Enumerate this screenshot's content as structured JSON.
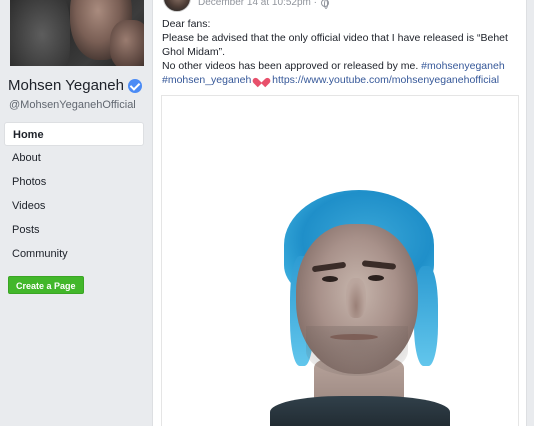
{
  "sidebar": {
    "page_name": "Mohsen Yeganeh",
    "handle": "@MohsenYeganehOfficial",
    "nav": [
      {
        "label": "Home"
      },
      {
        "label": "About"
      },
      {
        "label": "Photos"
      },
      {
        "label": "Videos"
      },
      {
        "label": "Posts"
      },
      {
        "label": "Community"
      }
    ],
    "create_page_label": "Create a Page"
  },
  "post": {
    "timestamp": "December 14 at 10:52pm · ",
    "lines": {
      "greeting": "Dear fans:",
      "line1": "Please be advised that the only official video that I have released is “Behet",
      "line2": "Ghol Midam”.",
      "line3_text": "No other videos has been approved or released by me. ",
      "hashtag1": "#mohsenyeganeh",
      "hashtag2": "#mohsen_yeganeh",
      "link": "https://www.youtube.com/mohsenyeganehofficial"
    }
  },
  "colors": {
    "accent_blue": "#365899",
    "create_green": "#42b72a",
    "verified_blue": "#4b8bf5",
    "heart_red": "#e8506b"
  },
  "icons": [
    "verified-badge-icon",
    "globe-icon",
    "heart-icon"
  ]
}
